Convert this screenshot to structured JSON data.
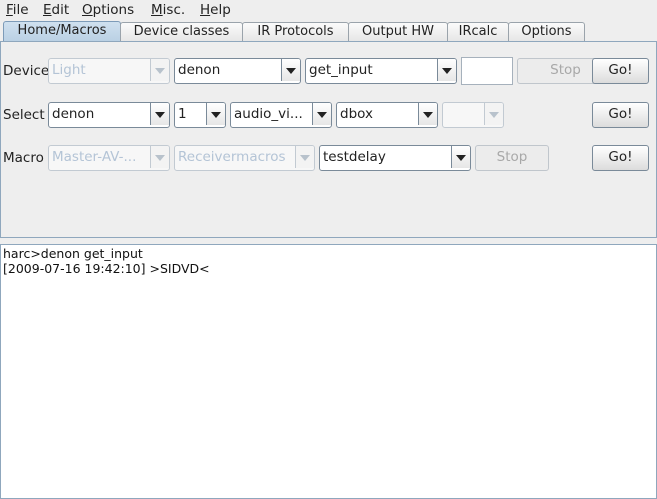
{
  "menubar": {
    "items": [
      "File",
      "Edit",
      "Options",
      "Misc.",
      "Help"
    ]
  },
  "tabs": [
    "Home/Macros",
    "Device classes",
    "IR Protocols",
    "Output HW",
    "IRcalc",
    "Options"
  ],
  "selected_tab": "Home/Macros",
  "device_row": {
    "label": "Device",
    "device_combo": "Light",
    "remote_combo": "denon",
    "command_combo": "get_input",
    "arg_field": "",
    "stop_label": "Stop",
    "go_label": "Go!"
  },
  "select_row": {
    "label": "Select",
    "device_combo": "denon",
    "zone_combo": "1",
    "mode_combo": "audio_vi...",
    "source_combo": "dbox",
    "extra_combo": "",
    "go_label": "Go!"
  },
  "macro_row": {
    "label": "Macro",
    "macro_combo": "Master-AV-...",
    "folder_combo": "Receivermacros",
    "action_combo": "testdelay",
    "stop_label": "Stop",
    "go_label": "Go!"
  },
  "console": {
    "lines": [
      "harc>denon get_input",
      "[2009-07-16 19:42:10] >SIDVD<"
    ]
  },
  "colors": {
    "selected_tab": "#b8cfe3",
    "disabled_text": "#b4c4d6",
    "border": "#7a8a99"
  }
}
